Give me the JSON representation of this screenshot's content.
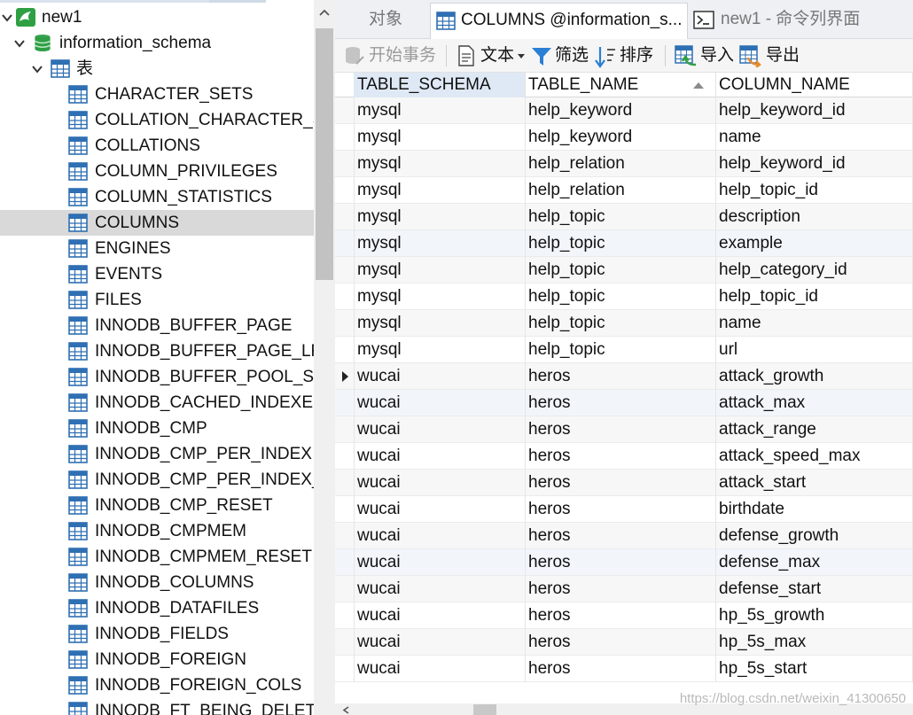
{
  "tree": {
    "connection": "new1",
    "database": "information_schema",
    "tables_group": "表",
    "tables": [
      "CHARACTER_SETS",
      "COLLATION_CHARACTER_SE",
      "COLLATIONS",
      "COLUMN_PRIVILEGES",
      "COLUMN_STATISTICS",
      "COLUMNS",
      "ENGINES",
      "EVENTS",
      "FILES",
      "INNODB_BUFFER_PAGE",
      "INNODB_BUFFER_PAGE_LRU",
      "INNODB_BUFFER_POOL_STA",
      "INNODB_CACHED_INDEXES",
      "INNODB_CMP",
      "INNODB_CMP_PER_INDEX",
      "INNODB_CMP_PER_INDEX_R",
      "INNODB_CMP_RESET",
      "INNODB_CMPMEM",
      "INNODB_CMPMEM_RESET",
      "INNODB_COLUMNS",
      "INNODB_DATAFILES",
      "INNODB_FIELDS",
      "INNODB_FOREIGN",
      "INNODB_FOREIGN_COLS",
      "INNODB_FT_BEING_DELETED"
    ],
    "selected_table": "COLUMNS"
  },
  "tabs": [
    {
      "label": "对象",
      "active": false
    },
    {
      "label": "COLUMNS @information_s...",
      "active": true
    },
    {
      "label": "new1 - 命令列界面",
      "active": false
    }
  ],
  "toolbar": {
    "begin_transaction": "开始事务",
    "text": "文本",
    "filter": "筛选",
    "sort": "排序",
    "import": "导入",
    "export": "导出"
  },
  "grid": {
    "columns": [
      "TABLE_SCHEMA",
      "TABLE_NAME",
      "COLUMN_NAME"
    ],
    "sorted_column": "TABLE_NAME",
    "rows": [
      [
        "mysql",
        "help_keyword",
        "help_keyword_id"
      ],
      [
        "mysql",
        "help_keyword",
        "name"
      ],
      [
        "mysql",
        "help_relation",
        "help_keyword_id"
      ],
      [
        "mysql",
        "help_relation",
        "help_topic_id"
      ],
      [
        "mysql",
        "help_topic",
        "description"
      ],
      [
        "mysql",
        "help_topic",
        "example"
      ],
      [
        "mysql",
        "help_topic",
        "help_category_id"
      ],
      [
        "mysql",
        "help_topic",
        "help_topic_id"
      ],
      [
        "mysql",
        "help_topic",
        "name"
      ],
      [
        "mysql",
        "help_topic",
        "url"
      ],
      [
        "wucai",
        "heros",
        "attack_growth"
      ],
      [
        "wucai",
        "heros",
        "attack_max"
      ],
      [
        "wucai",
        "heros",
        "attack_range"
      ],
      [
        "wucai",
        "heros",
        "attack_speed_max"
      ],
      [
        "wucai",
        "heros",
        "attack_start"
      ],
      [
        "wucai",
        "heros",
        "birthdate"
      ],
      [
        "wucai",
        "heros",
        "defense_growth"
      ],
      [
        "wucai",
        "heros",
        "defense_max"
      ],
      [
        "wucai",
        "heros",
        "defense_start"
      ],
      [
        "wucai",
        "heros",
        "hp_5s_growth"
      ],
      [
        "wucai",
        "heros",
        "hp_5s_max"
      ],
      [
        "wucai",
        "heros",
        "hp_5s_start"
      ]
    ],
    "current_row": 10
  },
  "watermark": "https://blog.csdn.net/weixin_41300650",
  "colors": {
    "selection": "#d9d9d9",
    "header_highlight": "#dfe9f5",
    "tab_bar": "#eef0f3",
    "db_icon": "#2e9e44",
    "table_icon": "#2f6fb3"
  }
}
